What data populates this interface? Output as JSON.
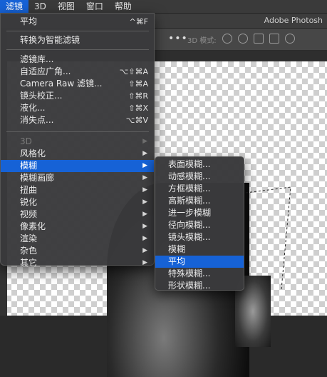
{
  "menubar": {
    "items": [
      {
        "label": "滤镜",
        "active": true
      },
      {
        "label": "3D"
      },
      {
        "label": "视图"
      },
      {
        "label": "窗口"
      },
      {
        "label": "帮助"
      }
    ]
  },
  "app": {
    "title": "Adobe Photosh"
  },
  "optbar": {
    "dots": "•••",
    "mode_label": "3D 模式:"
  },
  "filter_menu": {
    "last_filter": {
      "label": "平均",
      "shortcut": "^⌘F"
    },
    "convert_smart": {
      "label": "转换为智能滤镜"
    },
    "gallery": {
      "label": "滤镜库..."
    },
    "adaptive_wide": {
      "label": "自适应广角...",
      "shortcut": "⌥⇧⌘A"
    },
    "camera_raw": {
      "label": "Camera Raw 滤镜...",
      "shortcut": "⇧⌘A"
    },
    "lens_correction": {
      "label": "镜头校正...",
      "shortcut": "⇧⌘R"
    },
    "liquify": {
      "label": "液化...",
      "shortcut": "⇧⌘X"
    },
    "vanishing_point": {
      "label": "消失点...",
      "shortcut": "⌥⌘V"
    },
    "submenus": [
      {
        "label": "3D",
        "disabled": true
      },
      {
        "label": "风格化"
      },
      {
        "label": "模糊",
        "active": true
      },
      {
        "label": "模糊画廊"
      },
      {
        "label": "扭曲"
      },
      {
        "label": "锐化"
      },
      {
        "label": "视频"
      },
      {
        "label": "像素化"
      },
      {
        "label": "渲染"
      },
      {
        "label": "杂色"
      },
      {
        "label": "其它"
      }
    ],
    "arrow": "▶"
  },
  "blur_submenu": {
    "items": [
      {
        "label": "表面模糊..."
      },
      {
        "label": "动感模糊..."
      },
      {
        "label": "方框模糊..."
      },
      {
        "label": "高斯模糊..."
      },
      {
        "label": "进一步模糊"
      },
      {
        "label": "径向模糊..."
      },
      {
        "label": "镜头模糊..."
      },
      {
        "label": "模糊"
      },
      {
        "label": "平均",
        "active": true
      },
      {
        "label": "特殊模糊..."
      },
      {
        "label": "形状模糊..."
      }
    ]
  }
}
